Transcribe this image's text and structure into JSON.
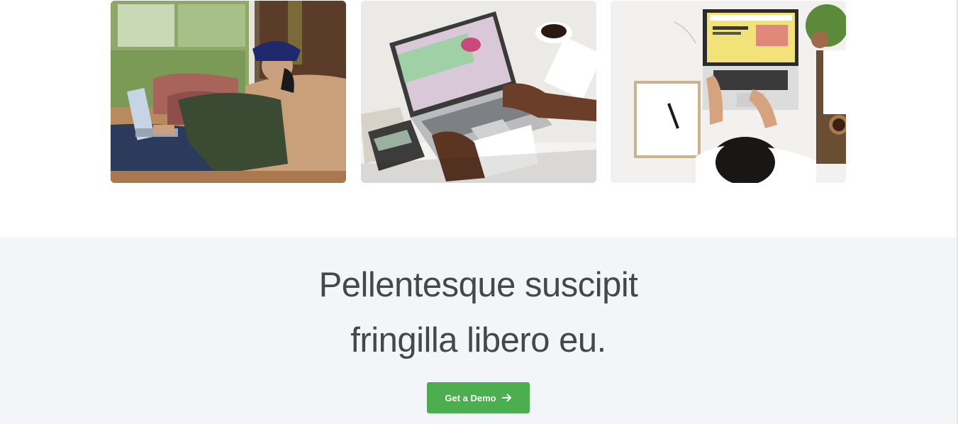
{
  "gallery": {
    "images": [
      {
        "alt": "woman-on-couch-with-laptop"
      },
      {
        "alt": "laptop-with-spreadsheet-and-calculator"
      },
      {
        "alt": "overhead-view-of-woman-at-laptop"
      }
    ]
  },
  "cta": {
    "headline_line1": "Pellentesque suscipit",
    "headline_line2": "fringilla libero eu.",
    "button_label": "Get a Demo",
    "button_icon": "arrow-right-icon"
  },
  "colors": {
    "cta_background": "#f4f5f9",
    "button": "#4cae4f",
    "headline": "#45474b"
  }
}
